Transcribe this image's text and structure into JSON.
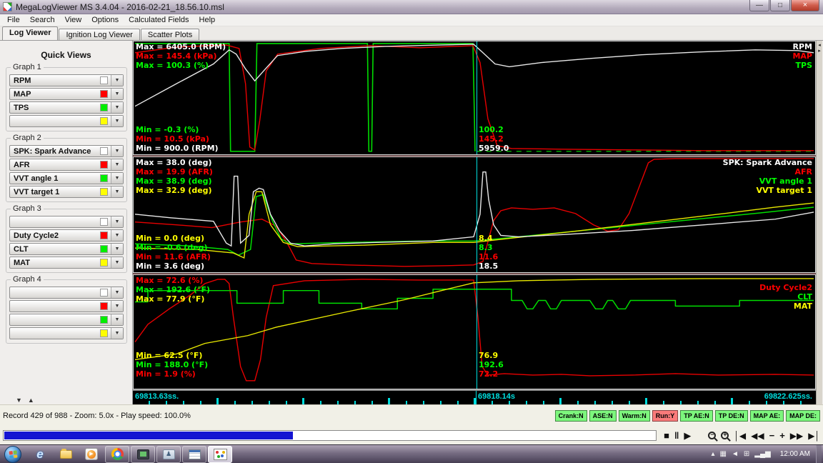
{
  "window": {
    "title": "MegaLogViewer MS 3.4.04 - 2016-02-21_18.56.10.msl",
    "controls": {
      "minimize": "—",
      "maximize": "□",
      "close": "×"
    }
  },
  "menu": [
    "File",
    "Search",
    "View",
    "Options",
    "Calculated Fields",
    "Help"
  ],
  "tabs": [
    "Log Viewer",
    "Ignition Log Viewer",
    "Scatter Plots"
  ],
  "sidebar": {
    "title": "Quick Views",
    "dd_arrow": "▼",
    "scroll_down": "▼",
    "scroll_up": "▲",
    "groups": [
      {
        "label": "Graph 1",
        "slots": [
          {
            "value": "RPM",
            "color": "#ffffff"
          },
          {
            "value": "MAP",
            "color": "#ff0000"
          },
          {
            "value": "TPS",
            "color": "#00ee00"
          },
          {
            "value": "",
            "color": "#ffff00"
          }
        ]
      },
      {
        "label": "Graph 2",
        "slots": [
          {
            "value": "SPK: Spark Advance",
            "color": "#ffffff"
          },
          {
            "value": "AFR",
            "color": "#ff0000"
          },
          {
            "value": "VVT angle 1",
            "color": "#00ee00"
          },
          {
            "value": "VVT target 1",
            "color": "#ffff00"
          }
        ]
      },
      {
        "label": "Graph 3",
        "slots": [
          {
            "value": "",
            "color": "#ffffff"
          },
          {
            "value": "Duty Cycle2",
            "color": "#ff0000"
          },
          {
            "value": "CLT",
            "color": "#00ee00"
          },
          {
            "value": "MAT",
            "color": "#ffff00"
          }
        ]
      },
      {
        "label": "Graph 4",
        "slots": [
          {
            "value": "",
            "color": "#ffffff"
          },
          {
            "value": "",
            "color": "#ff0000"
          },
          {
            "value": "",
            "color": "#00ee00"
          },
          {
            "value": "",
            "color": "#ffff00"
          }
        ]
      }
    ]
  },
  "graphs": [
    {
      "max": [
        {
          "t": "Max = 6405.0 (RPM)",
          "c": "#ffffff"
        },
        {
          "t": "Max = 145.4 (kPa)",
          "c": "#ff0000"
        },
        {
          "t": "Max = 100.3 (%)",
          "c": "#00ff00"
        }
      ],
      "min": [
        {
          "t": "Min = -0.3 (%)",
          "c": "#00ff00"
        },
        {
          "t": "Min = 10.5 (kPa)",
          "c": "#ff0000"
        },
        {
          "t": "Min = 900.0 (RPM)",
          "c": "#ffffff"
        }
      ],
      "cursor": [
        {
          "t": "100.2",
          "c": "#00ff00"
        },
        {
          "t": "145.2",
          "c": "#ff0000"
        },
        {
          "t": "5959.0",
          "c": "#ffffff"
        }
      ],
      "legend": [
        {
          "t": "RPM",
          "c": "#ffffff"
        },
        {
          "t": "MAP",
          "c": "#ff0000"
        },
        {
          "t": "TPS",
          "c": "#00ff00"
        }
      ]
    },
    {
      "max": [
        {
          "t": "Max = 38.0 (deg)",
          "c": "#ffffff"
        },
        {
          "t": "Max = 19.9 (AFR)",
          "c": "#ff0000"
        },
        {
          "t": "Max = 38.9 (deg)",
          "c": "#00ff00"
        },
        {
          "t": "Max = 32.9 (deg)",
          "c": "#ffff00"
        }
      ],
      "min": [
        {
          "t": "Min = 0.0 (deg)",
          "c": "#ffff00"
        },
        {
          "t": "Min = -0.6 (deg)",
          "c": "#00ff00"
        },
        {
          "t": "Min = 11.6 (AFR)",
          "c": "#ff0000"
        },
        {
          "t": "Min = 3.6 (deg)",
          "c": "#ffffff"
        }
      ],
      "cursor": [
        {
          "t": "8.4",
          "c": "#ffff00"
        },
        {
          "t": "8.3",
          "c": "#00ff00"
        },
        {
          "t": "11.6",
          "c": "#ff0000"
        },
        {
          "t": "18.5",
          "c": "#ffffff"
        }
      ],
      "legend": [
        {
          "t": "SPK: Spark Advance",
          "c": "#ffffff"
        },
        {
          "t": "AFR",
          "c": "#ff0000"
        },
        {
          "t": "VVT angle 1",
          "c": "#00ff00"
        },
        {
          "t": "VVT target 1",
          "c": "#ffff00"
        }
      ]
    },
    {
      "max": [
        {
          "t": "Max = 72.6 (%)",
          "c": "#ff0000"
        },
        {
          "t": "Max = 192.6 (°F)",
          "c": "#00ff00"
        },
        {
          "t": "Max = 77.9 (°F)",
          "c": "#ffff00"
        }
      ],
      "min": [
        {
          "t": "Min = 62.5 (°F)",
          "c": "#ffff00"
        },
        {
          "t": "Min = 188.0 (°F)",
          "c": "#00ff00"
        },
        {
          "t": "Min = 1.9 (%)",
          "c": "#ff0000"
        }
      ],
      "cursor": [
        {
          "t": "76.9",
          "c": "#ffff00"
        },
        {
          "t": "192.6",
          "c": "#00ff00"
        },
        {
          "t": "72.2",
          "c": "#ff0000"
        }
      ],
      "legend": [
        {
          "t": "Duty Cycle2",
          "c": "#ff0000"
        },
        {
          "t": "CLT",
          "c": "#00ff00"
        },
        {
          "t": "MAT",
          "c": "#ffff00"
        }
      ]
    }
  ],
  "timeline": {
    "start": "69813.63ss.",
    "cursor": "69818.14s",
    "end": "69822.625ss."
  },
  "status": {
    "record": "Record 429 of 988 - Zoom: 5.0x - Play speed: 100.0%",
    "indicators": [
      {
        "label": "Crank:N",
        "color": "#7df67d"
      },
      {
        "label": "ASE:N",
        "color": "#7df67d"
      },
      {
        "label": "Warm:N",
        "color": "#7df67d"
      },
      {
        "label": "Run:Y",
        "color": "#fa7a7a"
      },
      {
        "label": "TP AE:N",
        "color": "#7df67d"
      },
      {
        "label": "TP DE:N",
        "color": "#7df67d"
      },
      {
        "label": "MAP AE:",
        "color": "#7df67d"
      },
      {
        "label": "MAP DE:",
        "color": "#7df67d"
      }
    ]
  },
  "transport": {
    "stop": "■",
    "pause": "‖",
    "play": "▶",
    "zoom_out": "−",
    "zoom_in": "+",
    "skip_start": "│◀",
    "rewind": "◀◀",
    "minus": "−",
    "plus": "+",
    "ffwd": "▶▶",
    "skip_end": "▶│"
  },
  "scrollbar": {
    "left": "◂",
    "right": "▸"
  },
  "taskbar": {
    "clock": "12:00 AM",
    "hidden_icons": "▴"
  }
}
